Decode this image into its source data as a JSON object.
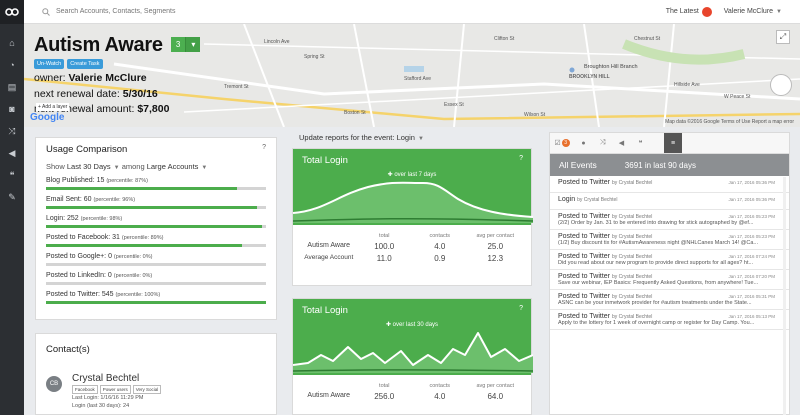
{
  "topbar": {
    "search_placeholder": "Search Accounts, Contacts, Segments",
    "latest_label": "The Latest",
    "user_name": "Valerie McClure"
  },
  "rail_icons": [
    "logo-icon",
    "home-icon",
    "dashboard-icon",
    "accounts-icon",
    "contacts-icon",
    "shuffle-icon",
    "megaphone-icon",
    "campaign-icon",
    "wrench-icon"
  ],
  "account": {
    "name": "Autism Aware",
    "score": "3",
    "tag_unwatch": "Un-Watch",
    "tag_task": "Create Task",
    "owner_label": "owner:",
    "owner_value": "Valerie McClure",
    "renewal_date_label": "next renewal date:",
    "renewal_date_value": "5/30/16",
    "renewal_amount_label": "next renewal amount:",
    "renewal_amount_value": "$7,800"
  },
  "map": {
    "google": "Google",
    "add_layer": "+ Add a layer",
    "footer": "Map data ©2016 Google   Terms of Use   Report a map error",
    "labels": [
      "Broughton Hill Branch",
      "BROOKLYN HILL",
      "W Peace St",
      "Hillside Ave",
      "Clifton St",
      "Stafford Ave",
      "Spring St",
      "Essex St",
      "Boston St",
      "Lincoln Ave",
      "Wilson St",
      "Chestnut St",
      "Tremont St"
    ]
  },
  "usage": {
    "title": "Usage Comparison",
    "help": "?",
    "show_label": "Show",
    "period": "Last 30 Days",
    "among_label": "among",
    "segment": "Large Accounts",
    "metrics": [
      {
        "label": "Blog Published: 15",
        "pct": "(percentile: 87%)",
        "value": 0.87
      },
      {
        "label": "Email Sent: 60",
        "pct": "(percentile: 96%)",
        "value": 0.96
      },
      {
        "label": "Login: 252",
        "pct": "(percentile: 98%)",
        "value": 0.98
      },
      {
        "label": "Posted to Facebook: 31",
        "pct": "(percentile: 89%)",
        "value": 0.89
      },
      {
        "label": "Posted to Google+: 0",
        "pct": "(percentile: 0%)",
        "value": 0.0
      },
      {
        "label": "Posted to LinkedIn: 0",
        "pct": "(percentile: 0%)",
        "value": 0.0
      },
      {
        "label": "Posted to Twitter: 545",
        "pct": "(percentile: 100%)",
        "value": 1.0
      }
    ]
  },
  "contacts": {
    "title": "Contact(s)",
    "items": [
      {
        "initials": "CB",
        "name": "Crystal Bechtel",
        "tags": [
          "Facebook",
          "Power users",
          "Very Social"
        ],
        "last_login": "Last Login: 1/16/16 11:29 PM",
        "logins": "Login (last 30 days): 24"
      }
    ]
  },
  "updates": {
    "label": "Update reports for the event:",
    "event": "Login"
  },
  "charts": [
    {
      "title": "Total Login",
      "note": "over last 7 days",
      "help": "?",
      "headers": [
        "total",
        "contacts",
        "avg per contact"
      ],
      "rows": [
        {
          "name": "Autism Aware",
          "values": [
            "100.0",
            "4.0",
            "25.0"
          ]
        },
        {
          "name": "Average Account",
          "values": [
            "11.0",
            "0.9",
            "12.3"
          ]
        }
      ]
    },
    {
      "title": "Total Login",
      "note": "over last 30 days",
      "help": "?",
      "headers": [
        "total",
        "contacts",
        "avg per contact"
      ],
      "rows": [
        {
          "name": "Autism Aware",
          "values": [
            "256.0",
            "4.0",
            "64.0"
          ]
        }
      ]
    }
  ],
  "events": {
    "badge": "3",
    "title": "All Events",
    "count": "3691 in last 90 days",
    "items": [
      {
        "title": "Posted to Twitter",
        "by": "by Crystal Bechtel",
        "date": "Jan 17, 2016 05:36 PM",
        "text": ""
      },
      {
        "title": "Login",
        "by": "by Crystal Bechtel",
        "date": "Jan 17, 2016 05:36 PM",
        "text": ""
      },
      {
        "title": "Posted to Twitter",
        "by": "by Crystal Bechtel",
        "date": "Jan 17, 2016 05:23 PM",
        "text": "(2/2) Order by Jan. 31 to be entered into drawing for stick autographed by @ef..."
      },
      {
        "title": "Posted to Twitter",
        "by": "by Crystal Bechtel",
        "date": "Jan 17, 2016 05:23 PM",
        "text": "(1/2) Buy discount tix for #AutismAwareness night @NHLCanes March 14! @Ca..."
      },
      {
        "title": "Posted to Twitter",
        "by": "by Crystal Bechtel",
        "date": "Jan 17, 2016 07:24 PM",
        "text": "Did you read about our new program to provide direct supports for all ages? ht..."
      },
      {
        "title": "Posted to Twitter",
        "by": "by Crystal Bechtel",
        "date": "Jan 17, 2016 07:20 PM",
        "text": "Save our webinar, IEP Basics: Frequently Asked Questions, from anywhere! Tue..."
      },
      {
        "title": "Posted to Twitter",
        "by": "by Crystal Bechtel",
        "date": "Jan 17, 2016 05:31 PM",
        "text": "ASNC can be your inmetwork provider for #autism treatments under the State..."
      },
      {
        "title": "Posted to Twitter",
        "by": "by Crystal Bechtel",
        "date": "Jan 17, 2016 05:13 PM",
        "text": "Apply to the lottery for 1 week of overnight camp or register for Day Camp. You..."
      }
    ]
  }
}
